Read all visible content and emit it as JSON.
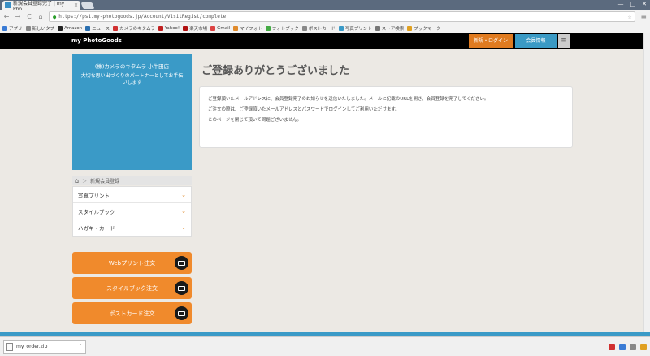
{
  "browser": {
    "tab_title": "新規会員登録完了 | my Pho...",
    "tab_close": "×",
    "window_controls": [
      "—",
      "□",
      "✕"
    ],
    "back": "←",
    "forward": "→",
    "reload": "C",
    "home": "⌂",
    "url": "https://ps1.my-photogoods.jp/Account/VisitRegist/complete",
    "menu": "≡",
    "bookmarks": [
      {
        "label": "アプリ",
        "color": "#3a7bd5"
      },
      {
        "label": "新しいタブ",
        "color": "#888"
      },
      {
        "label": "Amazon",
        "color": "#222"
      },
      {
        "label": "ニュース",
        "color": "#2a6fb0"
      },
      {
        "label": "カメラのキタムラ",
        "color": "#d03030"
      },
      {
        "label": "Yahoo!",
        "color": "#c02020"
      },
      {
        "label": "楽天市場",
        "color": "#b01010"
      },
      {
        "label": "Gmail",
        "color": "#d44"
      },
      {
        "label": "マイフォト",
        "color": "#e08a2a"
      },
      {
        "label": "フォトブック",
        "color": "#4a4"
      },
      {
        "label": "ポストカード",
        "color": "#888"
      },
      {
        "label": "写真プリント",
        "color": "#3a9ac7"
      },
      {
        "label": "ストア検索",
        "color": "#777"
      },
      {
        "label": "ブックマーク",
        "color": "#e0a020"
      }
    ]
  },
  "site": {
    "logo": "my PhotoGoods",
    "login_label": "新規・ログイン",
    "member_label": "会員情報",
    "menu_icon": "≡"
  },
  "sidebar": {
    "store_name": "(株)カメラのキタムラ 小牛田店",
    "store_tagline": "大切な思い出づくりのパートナーとしてお手伝いします",
    "breadcrumb_home_icon": "home-icon",
    "breadcrumb_sep": "＞",
    "breadcrumb_current": "新規会員登録",
    "menu_items": [
      {
        "label": "写真プリント",
        "chev": "⌄"
      },
      {
        "label": "スタイルブック",
        "chev": "⌄"
      },
      {
        "label": "ハガキ・カード",
        "chev": "⌄"
      }
    ],
    "order_buttons": [
      {
        "label": "Webプリント注文"
      },
      {
        "label": "スタイルブック注文"
      },
      {
        "label": "ポストカード注文"
      }
    ]
  },
  "main": {
    "title": "ご登録ありがとうございました",
    "paragraphs": [
      "ご登録頂いたメールアドレスに、会員登録完了のお知らせを送信いたしました。メールに記載のURLを開き、会員登録を完了してください。",
      "ご注文の際は、ご登録頂いたメールアドレスとパスワードでログインしてご利用いただけます。",
      "このページを閉じて頂いて問題ございません。"
    ]
  },
  "downloads": {
    "file_name": "my_order.zip",
    "caret": "⌃"
  }
}
